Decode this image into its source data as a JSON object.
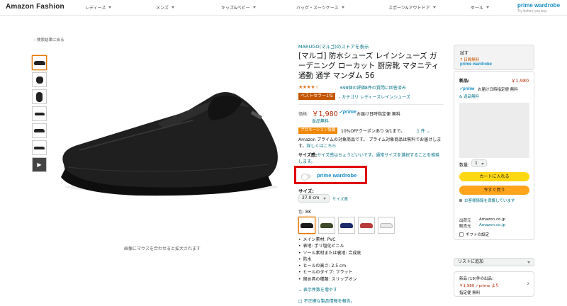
{
  "nav": {
    "brand": "Amazon Fashion",
    "items": [
      "レディース",
      "メンズ",
      "キッズ&ベビー",
      "バッグ・スーツケース",
      "スポーツ&アウトドア",
      "セール"
    ],
    "logo_line1": "prime wardrobe",
    "logo_line2": "Try before you buy"
  },
  "back_link": "‹ 検索結果に戻る",
  "gallery": {
    "hover_hint": "画像にマウスを合わせると拡大されます",
    "thumb_count": 7
  },
  "product": {
    "store": "MARUGO(マルゴ)のストアを表示",
    "title": "[マルゴ] 防水シューズ レインシューズ ガーデニング ローカット 厨房靴 マタニティ 通勤 通学 マンダム 56",
    "stars": "★★★★☆",
    "rating_count": "698個の評価",
    "qa_count": "8件の質問に回答済み",
    "bestseller_badge": "ベストセラー1位",
    "bestseller_category": "- カテゴリ レディースレインシューズ",
    "price_label": "価格:",
    "price": "￥1,980",
    "prime": "✓prime",
    "shipping": "お届け日時指定便 無料",
    "returns": "返品無料",
    "promo_badge": "プロモーション情報",
    "promo_text": "10%OFFクーポンあり 9/1まで。",
    "promo_more": "1 件 ⌄",
    "prime_note": "Amazon プライムの対象商品です。 プライム対象商品は無料でお届けします。",
    "prime_note_link": "詳しくはこちら",
    "size_guide_label": "サイズ感:",
    "size_guide_text": "サイズ感はちょうどいいです。通常サイズを選択することを推奨します。",
    "prime_wardrobe_label": "prime wardrobe",
    "size_label": "サイズ:",
    "size_value": "27.0 cm",
    "size_chart": "サイズ表",
    "color_label": "色:",
    "color_value": "BK",
    "swatch_colors": [
      "#1a1a1a",
      "#3f4a2a",
      "#1d2a6b",
      "#b83a3a",
      "#e8e8e8"
    ],
    "bullets": [
      "メイン素材: PVC",
      "表地: ポリ塩化ビニル",
      "ソール素材または裏地: 合成底",
      "防水",
      "ヒールの高さ: 2.5 cm",
      "ヒールのタイプ: フラット",
      "留め具の種類: スリップオン"
    ],
    "more_link": "⌄ 表示件数を増やす",
    "report_link": "不正確な製品情報を報告。"
  },
  "trial": {
    "line1": "試す",
    "line2": "7 日間無料",
    "line3": "prime wardrobe"
  },
  "buybox": {
    "new_label": "新品:",
    "price": "￥1,980",
    "prime": "✓prime",
    "shipping": "お届け日時指定便 無料",
    "returns": "& 返品無料",
    "qty_label": "数量:",
    "qty_value": "1",
    "add_to_cart": "カートに入れる",
    "buy_now": "今すぐ買う",
    "secure": "お客様情報を保護しています",
    "shipper_label": "出荷元",
    "shipper": "Amazon.co.jp",
    "seller_label": "販売元",
    "seller": "Amazon.co.jp",
    "gift": "ギフトの設定"
  },
  "list_button": "リストに追加",
  "offers": {
    "line1": "新品 (19)件の出品：",
    "line2": "￥1,980 ✓prime より",
    "line3": "指定便 無料"
  },
  "colors": {
    "link": "#007185",
    "price": "#b12704",
    "prime_blue": "#1a8fc9",
    "cart_yellow": "#ffd814",
    "buy_orange": "#ffa41c",
    "highlight_red": "#e00000"
  }
}
